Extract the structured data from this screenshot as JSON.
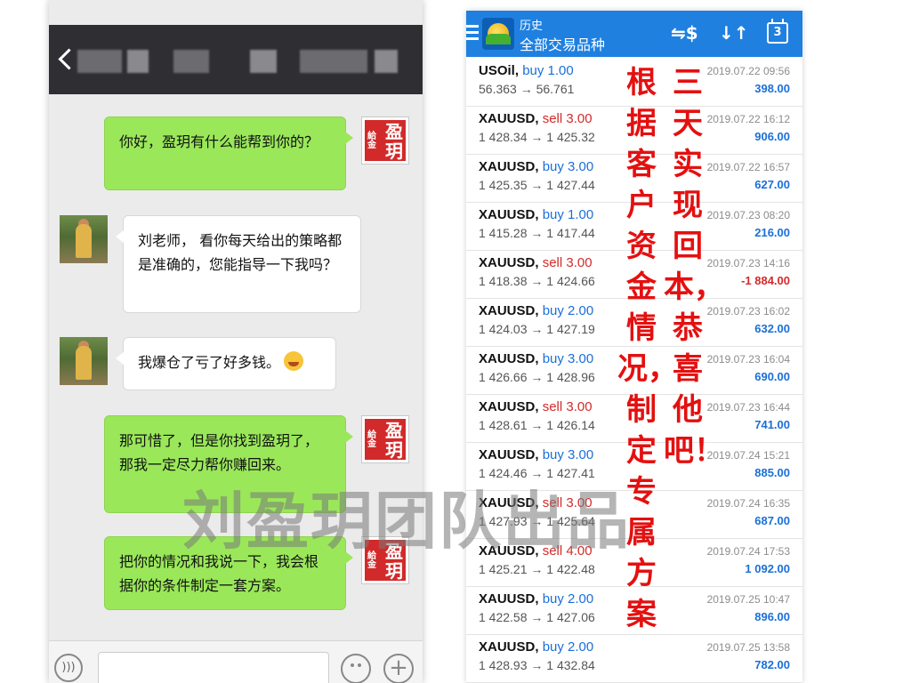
{
  "chat": {
    "messages": [
      {
        "side": "self",
        "text": "你好，盈玥有什么能帮到你的？"
      },
      {
        "side": "user",
        "text": "刘老师， 看你每天给出的策略都是准确的，您能指导一下我吗？"
      },
      {
        "side": "user",
        "text": "我爆仓了亏了好多钱。"
      },
      {
        "side": "self",
        "text": "那可惜了，但是你找到盈玥了，那我一定尽力帮你赚回来。"
      },
      {
        "side": "self",
        "text": "把你的情况和我说一下，我会根据你的条件制定一套方案。"
      }
    ],
    "avatar_seal": {
      "char1": "盈",
      "char2": "玥",
      "small": "給金"
    }
  },
  "mt4": {
    "title": "历史",
    "subtitle": "全部交易品种",
    "calendar_badge": "3",
    "icons": [
      "menu-icon",
      "app-logo",
      "currency-exchange-icon",
      "sort-icon",
      "calendar-icon"
    ],
    "trades": [
      {
        "symbol": "USOil",
        "side": "buy",
        "lots": "1.00",
        "prices": "56.363 → 56.761",
        "date": "2019.07.22 09:56",
        "profit": "398.00"
      },
      {
        "symbol": "XAUUSD",
        "side": "sell",
        "lots": "3.00",
        "prices": "1 428.34 → 1 425.32",
        "date": "2019.07.22 16:12",
        "profit": "906.00"
      },
      {
        "symbol": "XAUUSD",
        "side": "buy",
        "lots": "3.00",
        "prices": "1 425.35 → 1 427.44",
        "date": "2019.07.22 16:57",
        "profit": "627.00"
      },
      {
        "symbol": "XAUUSD",
        "side": "buy",
        "lots": "1.00",
        "prices": "1 415.28 → 1 417.44",
        "date": "2019.07.23 08:20",
        "profit": "216.00"
      },
      {
        "symbol": "XAUUSD",
        "side": "sell",
        "lots": "3.00",
        "prices": "1 418.38 → 1 424.66",
        "date": "2019.07.23 14:16",
        "profit": "-1 884.00"
      },
      {
        "symbol": "XAUUSD",
        "side": "buy",
        "lots": "2.00",
        "prices": "1 424.03 → 1 427.19",
        "date": "2019.07.23 16:02",
        "profit": "632.00"
      },
      {
        "symbol": "XAUUSD",
        "side": "buy",
        "lots": "3.00",
        "prices": "1 426.66 → 1 428.96",
        "date": "2019.07.23 16:04",
        "profit": "690.00"
      },
      {
        "symbol": "XAUUSD",
        "side": "sell",
        "lots": "3.00",
        "prices": "1 428.61 → 1 426.14",
        "date": "2019.07.23 16:44",
        "profit": "741.00"
      },
      {
        "symbol": "XAUUSD",
        "side": "buy",
        "lots": "3.00",
        "prices": "1 424.46 → 1 427.41",
        "date": "2019.07.24 15:21",
        "profit": "885.00"
      },
      {
        "symbol": "XAUUSD",
        "side": "sell",
        "lots": "3.00",
        "prices": "1 427.93 → 1 425.64",
        "date": "2019.07.24 16:35",
        "profit": "687.00"
      },
      {
        "symbol": "XAUUSD",
        "side": "sell",
        "lots": "4.00",
        "prices": "1 425.21 → 1 422.48",
        "date": "2019.07.24 17:53",
        "profit": "1 092.00"
      },
      {
        "symbol": "XAUUSD",
        "side": "buy",
        "lots": "2.00",
        "prices": "1 422.58 → 1 427.06",
        "date": "2019.07.25 10:47",
        "profit": "896.00"
      },
      {
        "symbol": "XAUUSD",
        "side": "buy",
        "lots": "2.00",
        "prices": "1 428.93 → 1 432.84",
        "date": "2019.07.25 13:58",
        "profit": "782.00"
      }
    ]
  },
  "overlay": {
    "column_left": "根据客户资金情况，制定专属方案",
    "column_right": "三天实现回本，恭喜他吧！",
    "color": "#e41010"
  },
  "watermark": "刘盈玥团队出品"
}
